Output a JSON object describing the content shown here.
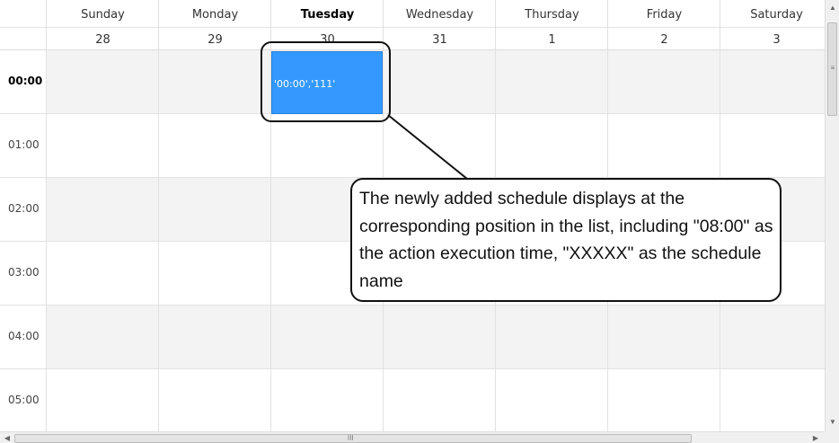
{
  "header": {
    "days": [
      "Sunday",
      "Monday",
      "Tuesday",
      "Wednesday",
      "Thursday",
      "Friday",
      "Saturday"
    ],
    "dates": [
      "28",
      "29",
      "30",
      "31",
      "1",
      "2",
      "3"
    ],
    "today_index": 2
  },
  "time_slots": [
    "00:00",
    "01:00",
    "02:00",
    "03:00",
    "04:00",
    "05:00"
  ],
  "event": {
    "text": "'00:00','111'",
    "color": "#3399ff"
  },
  "annotation": {
    "text": "The newly added schedule displays at the corresponding position in the list, including \"08:00\" as the action execution time, \"XXXXX\" as the schedule name"
  },
  "scrollbars": {
    "up_arrow": "▲",
    "down_arrow": "▼",
    "left_arrow": "◀",
    "right_arrow": "▶",
    "v_grip": "≡",
    "h_grip": "III"
  }
}
